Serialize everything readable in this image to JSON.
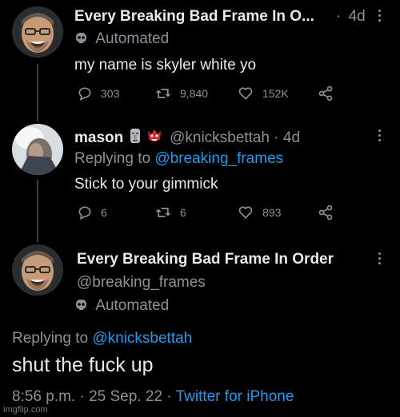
{
  "tweet1": {
    "display_name": "Every Breaking Bad Frame In O...",
    "time": "4d",
    "automated_label": "Automated",
    "text": "my name is skyler white yo",
    "actions": {
      "replies": "303",
      "retweets": "9,840",
      "likes": "152K"
    }
  },
  "tweet2": {
    "display_name": "mason",
    "handle": "@knicksbettah",
    "time": "4d",
    "replying_to_prefix": "Replying to",
    "replying_to_handle": "@breaking_frames",
    "text": "Stick to your gimmick",
    "actions": {
      "replies": "6",
      "retweets": "6",
      "likes": "893"
    }
  },
  "tweet3": {
    "display_name": "Every Breaking Bad Frame In Order",
    "handle": "@breaking_frames",
    "automated_label": "Automated",
    "replying_to_prefix": "Replying to",
    "replying_to_handle": "@knicksbettah",
    "text": "shut the fuck up",
    "timestamp": "8:56 p.m. · 25 Sep. 22",
    "client": "Twitter for iPhone"
  },
  "separator": "·",
  "watermark": "imgflip.com",
  "colors": {
    "background": "#000000",
    "text": "#e7e9ea",
    "muted": "#8b9198",
    "link": "#1d9bf0",
    "thread_line": "#3a3e42"
  },
  "icons": [
    "reply-icon",
    "retweet-icon",
    "like-icon",
    "share-icon",
    "more-icon",
    "robot-icon",
    "moai-emoji",
    "goblin-emoji"
  ]
}
